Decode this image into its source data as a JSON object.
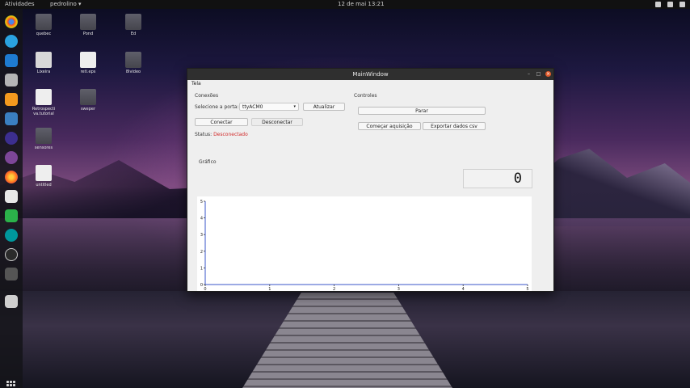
{
  "topbar": {
    "activities": "Atividades",
    "app_menu": "pedrolino ▾",
    "clock": "12 de mai  13:21"
  },
  "desktop": {
    "icons": [
      {
        "label": "quebec"
      },
      {
        "label": "Pond"
      },
      {
        "label": "Ed"
      },
      {
        "label": "Lixeira"
      },
      {
        "label": "reti.eps"
      },
      {
        "label": "8lvideo"
      },
      {
        "label": "Retrospecti va.tutorial"
      },
      {
        "label": "sweper"
      },
      {
        "label": "sensores"
      },
      {
        "label": "untitled"
      }
    ]
  },
  "window": {
    "title": "MainWindow",
    "menu": "Tela",
    "connections": {
      "title": "Conexões",
      "port_label": "Selecione a porta:",
      "port_value": "ttyACM0",
      "refresh_button": "Atualizar",
      "connect_button": "Conectar",
      "disconnect_button": "Desconectar",
      "status_label": "Status:",
      "status_value": "Desconectado"
    },
    "controls": {
      "title": "Controles",
      "stop_button": "Parar",
      "start_button": "Começar aquisição",
      "export_button": "Exportar dados csv"
    },
    "graph_label": "Gráfico",
    "lcd_value": "0"
  },
  "chart_data": {
    "type": "line",
    "x_ticks": [
      "0",
      "1",
      "2",
      "3",
      "4",
      "5"
    ],
    "y_ticks": [
      "0",
      "1",
      "2",
      "3",
      "4",
      "5"
    ],
    "xlim": [
      0,
      5
    ],
    "ylim": [
      0,
      5
    ],
    "series": [],
    "grid": false
  },
  "colors": {
    "status_red": "#d12b2b",
    "axis_blue": "#3a56c8",
    "close_orange": "#e05a2b"
  }
}
